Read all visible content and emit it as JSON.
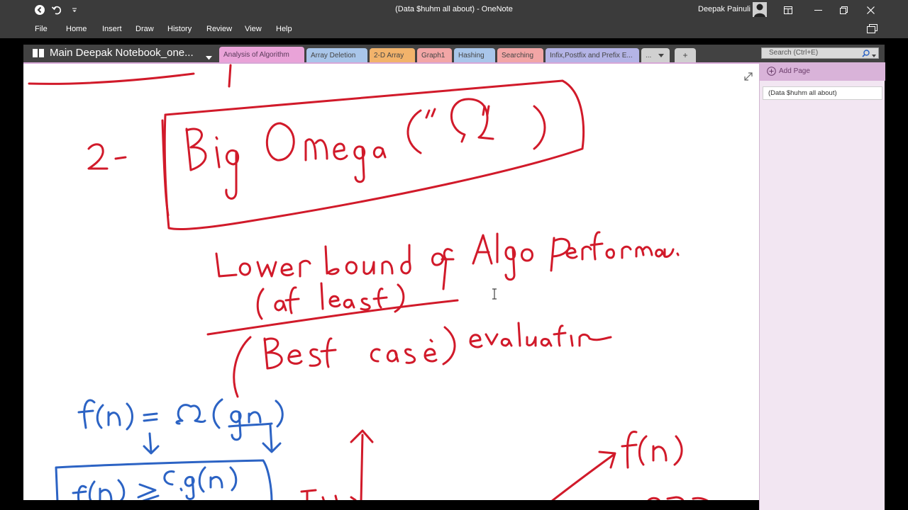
{
  "window": {
    "title": "(Data $huhm all about)  -  OneNote",
    "user_name": "Deepak Painuli"
  },
  "menu": {
    "items": [
      "File",
      "Home",
      "Insert",
      "Draw",
      "History",
      "Review",
      "View",
      "Help"
    ]
  },
  "notebook": {
    "name": "Main Deepak Notebook_one..."
  },
  "section_tabs": [
    {
      "label": "Analysis of Algorithm",
      "color": "#e9a3d8",
      "active": true
    },
    {
      "label": "Array Deletion",
      "color": "#a9c6ea"
    },
    {
      "label": "2-D Array",
      "color": "#f2b36b"
    },
    {
      "label": "Graph1",
      "color": "#f2a6a6"
    },
    {
      "label": "Hashing",
      "color": "#a9c6ea"
    },
    {
      "label": "Searching",
      "color": "#f2a6a6"
    },
    {
      "label": "Infix,Postfix and Prefix E...",
      "color": "#b4b4e6"
    },
    {
      "label": "...",
      "color": "#d0d0d0"
    },
    {
      "label": "+",
      "color": "#d0d0d0"
    }
  ],
  "search": {
    "placeholder": "Search (Ctrl+E)"
  },
  "page_panel": {
    "add_page_label": "Add Page",
    "pages": [
      "(Data $huhm all about)"
    ]
  },
  "colors": {
    "titlebar": "#3b3b3b",
    "ink_red": "#d11a2a",
    "ink_blue": "#2c63c4",
    "accent": "#d9b3d9"
  },
  "icons": [
    "back-icon",
    "undo-icon",
    "quick-access-icon",
    "ribbon-display-icon",
    "minimize-icon",
    "restore-icon",
    "close-icon",
    "notebook-icon",
    "search-icon",
    "add-page-icon",
    "expand-icon"
  ]
}
